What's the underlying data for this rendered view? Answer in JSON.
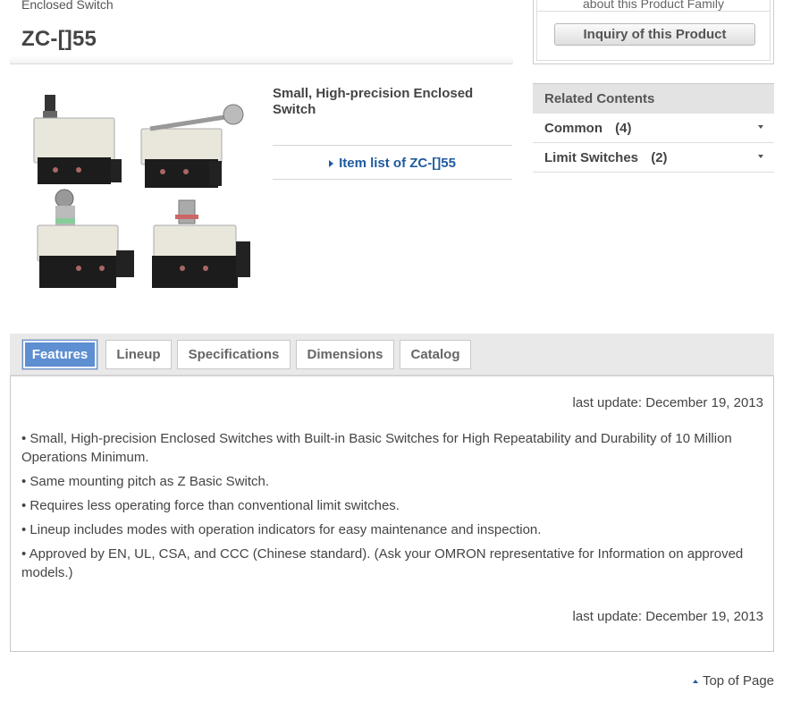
{
  "breadcrumb": "Enclosed Switch",
  "page_title": "ZC-[]55",
  "product": {
    "name": "Small, High-precision Enclosed Switch",
    "item_list_link": "Item list of ZC-[]55"
  },
  "inquiry": {
    "top_text": "about this Product Family",
    "button_label": "Inquiry of this Product"
  },
  "related": {
    "header": "Related Contents",
    "items": [
      {
        "label": "Common",
        "count": "(4)"
      },
      {
        "label": "Limit Switches",
        "count": "(2)"
      }
    ]
  },
  "tabs": [
    {
      "label": "Features",
      "active": true
    },
    {
      "label": "Lineup",
      "active": false
    },
    {
      "label": "Specifications",
      "active": false
    },
    {
      "label": "Dimensions",
      "active": false
    },
    {
      "label": "Catalog",
      "active": false
    }
  ],
  "content": {
    "last_update": "last update: December 19, 2013",
    "features": [
      "• Small, High-precision Enclosed Switches with Built-in Basic Switches for High Repeatability and Durability of 10 Million Operations Minimum.",
      "• Same mounting pitch as Z Basic Switch.",
      "• Requires less operating force than conventional limit switches.",
      "• Lineup includes modes with operation indicators for easy maintenance and inspection.",
      "• Approved by EN, UL, CSA, and CCC (Chinese standard). (Ask your OMRON representative for Information on approved models.)"
    ]
  },
  "footer": {
    "top_of_page": "Top of Page"
  },
  "colors": {
    "link": "#1f5a9e",
    "active_tab": "#5d8fd2"
  }
}
